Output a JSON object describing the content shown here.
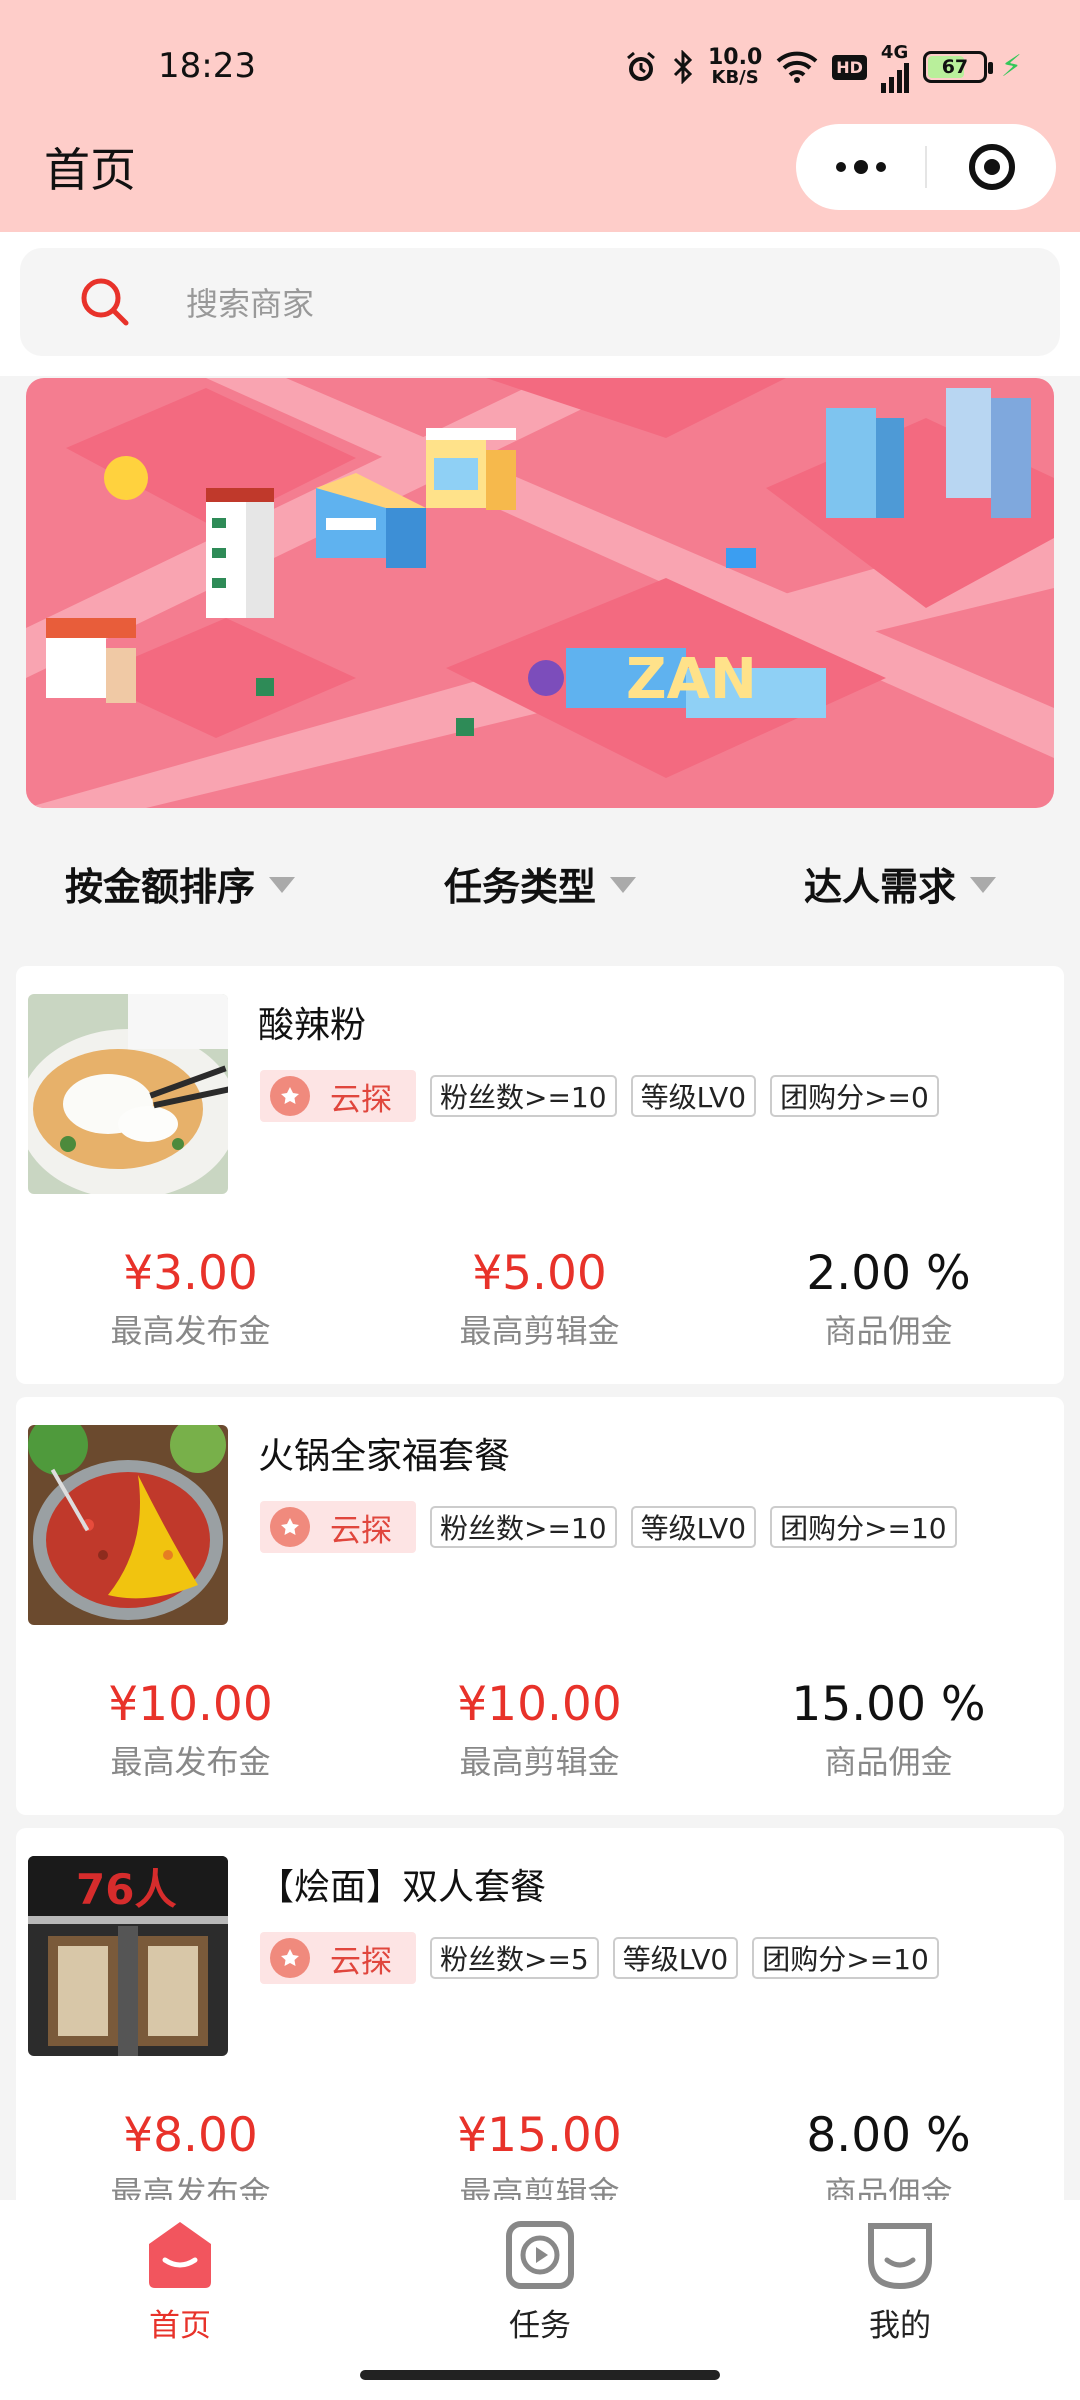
{
  "status_bar": {
    "time": "18:23",
    "net_speed_value": "10.0",
    "net_speed_unit": "KB/S",
    "hd": "HD",
    "signal": "4G",
    "battery": "67"
  },
  "nav": {
    "title": "首页"
  },
  "search": {
    "placeholder": "搜索商家"
  },
  "filters": [
    {
      "label": "按金额排序"
    },
    {
      "label": "任务类型"
    },
    {
      "label": "达人需求"
    }
  ],
  "cards": [
    {
      "title": "酸辣粉",
      "badge": "云探",
      "tags": [
        "粉丝数>=10",
        "等级LV0",
        "团购分>=0"
      ],
      "stats": [
        {
          "value": "¥3.00",
          "label": "最高发布金"
        },
        {
          "value": "¥5.00",
          "label": "最高剪辑金"
        },
        {
          "value": "2.00 %",
          "label": "商品佣金"
        }
      ]
    },
    {
      "title": "火锅全家福套餐",
      "badge": "云探",
      "tags": [
        "粉丝数>=10",
        "等级LV0",
        "团购分>=10"
      ],
      "stats": [
        {
          "value": "¥10.00",
          "label": "最高发布金"
        },
        {
          "value": "¥10.00",
          "label": "最高剪辑金"
        },
        {
          "value": "15.00 %",
          "label": "商品佣金"
        }
      ]
    },
    {
      "title": "【烩面】双人套餐",
      "badge": "云探",
      "tags": [
        "粉丝数>=5",
        "等级LV0",
        "团购分>=10"
      ],
      "stats": [
        {
          "value": "¥8.00",
          "label": "最高发布金"
        },
        {
          "value": "¥15.00",
          "label": "最高剪辑金"
        },
        {
          "value": "8.00 %",
          "label": "商品佣金"
        }
      ],
      "logo_text": "76人"
    }
  ],
  "tabbar": [
    {
      "label": "首页",
      "icon": "home-icon",
      "active": true
    },
    {
      "label": "任务",
      "icon": "task-play-icon",
      "active": false
    },
    {
      "label": "我的",
      "icon": "profile-face-icon",
      "active": false
    }
  ],
  "colors": {
    "header_bg": "#fecdc9",
    "accent_red": "#e8322a",
    "badge_bg": "#fde4e4"
  }
}
